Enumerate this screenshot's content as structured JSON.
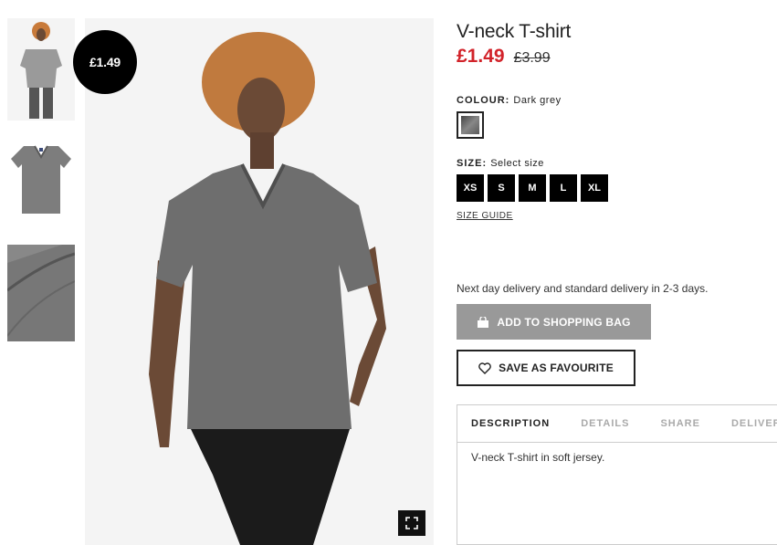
{
  "gallery": {
    "badge_price": "£1.49",
    "thumbnails": [
      "model-front",
      "flat-lay",
      "fabric-close-up"
    ],
    "expand_icon": "fullscreen-icon"
  },
  "product": {
    "title": "V-neck T-shirt",
    "price_sale": "£1.49",
    "price_old": "£3.99"
  },
  "colour": {
    "label": "COLOUR:",
    "value": "Dark grey",
    "swatch_color": "#666666"
  },
  "size": {
    "label": "SIZE:",
    "value": "Select size",
    "options": [
      "XS",
      "S",
      "M",
      "L",
      "XL"
    ],
    "guide": "SIZE GUIDE"
  },
  "delivery_note": "Next day delivery and standard delivery in 2-3 days.",
  "actions": {
    "add_to_bag": "ADD TO SHOPPING BAG",
    "save_favourite": "SAVE AS FAVOURITE",
    "bag_icon": "bag-icon",
    "heart_icon": "heart-icon"
  },
  "tabs": {
    "items": [
      "DESCRIPTION",
      "DETAILS",
      "SHARE",
      "DELIVERY"
    ],
    "active": "DESCRIPTION",
    "description_text": "V-neck T-shirt in soft jersey."
  },
  "colors": {
    "sale_red": "#d2232a",
    "disabled_button": "#999999",
    "black": "#000000"
  }
}
